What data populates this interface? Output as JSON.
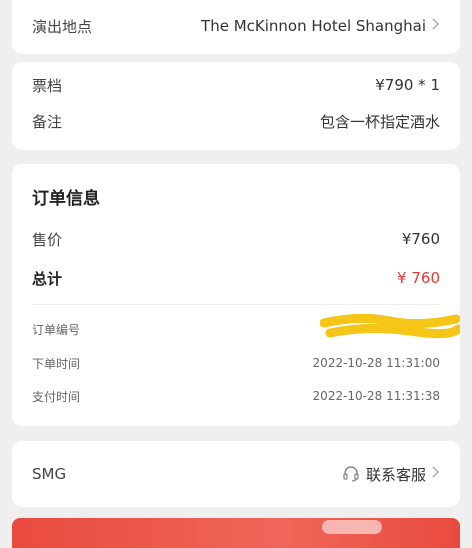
{
  "venue": {
    "label": "演出地点",
    "value": "The McKinnon Hotel Shanghai"
  },
  "ticket": {
    "tier": {
      "label": "票档",
      "value": "¥790 * 1"
    },
    "note": {
      "label": "备注",
      "value": "包含一杯指定酒水"
    }
  },
  "order": {
    "title": "订单信息",
    "price": {
      "label": "售价",
      "value": "¥760"
    },
    "total": {
      "label": "总计",
      "value": "¥ 760"
    },
    "number": {
      "label": "订单编号"
    },
    "created": {
      "label": "下单时间",
      "value": "2022-10-28 11:31:00"
    },
    "paid": {
      "label": "支付时间",
      "value": "2022-10-28 11:31:38"
    }
  },
  "support": {
    "org": "SMG",
    "contact_label": "联系客服"
  },
  "colors": {
    "accent": "#e53935",
    "redaction": "#f5c518",
    "banner": "#e94a3f"
  },
  "icons": {
    "chevron": "chevron-right-icon",
    "headset": "headset-icon"
  }
}
